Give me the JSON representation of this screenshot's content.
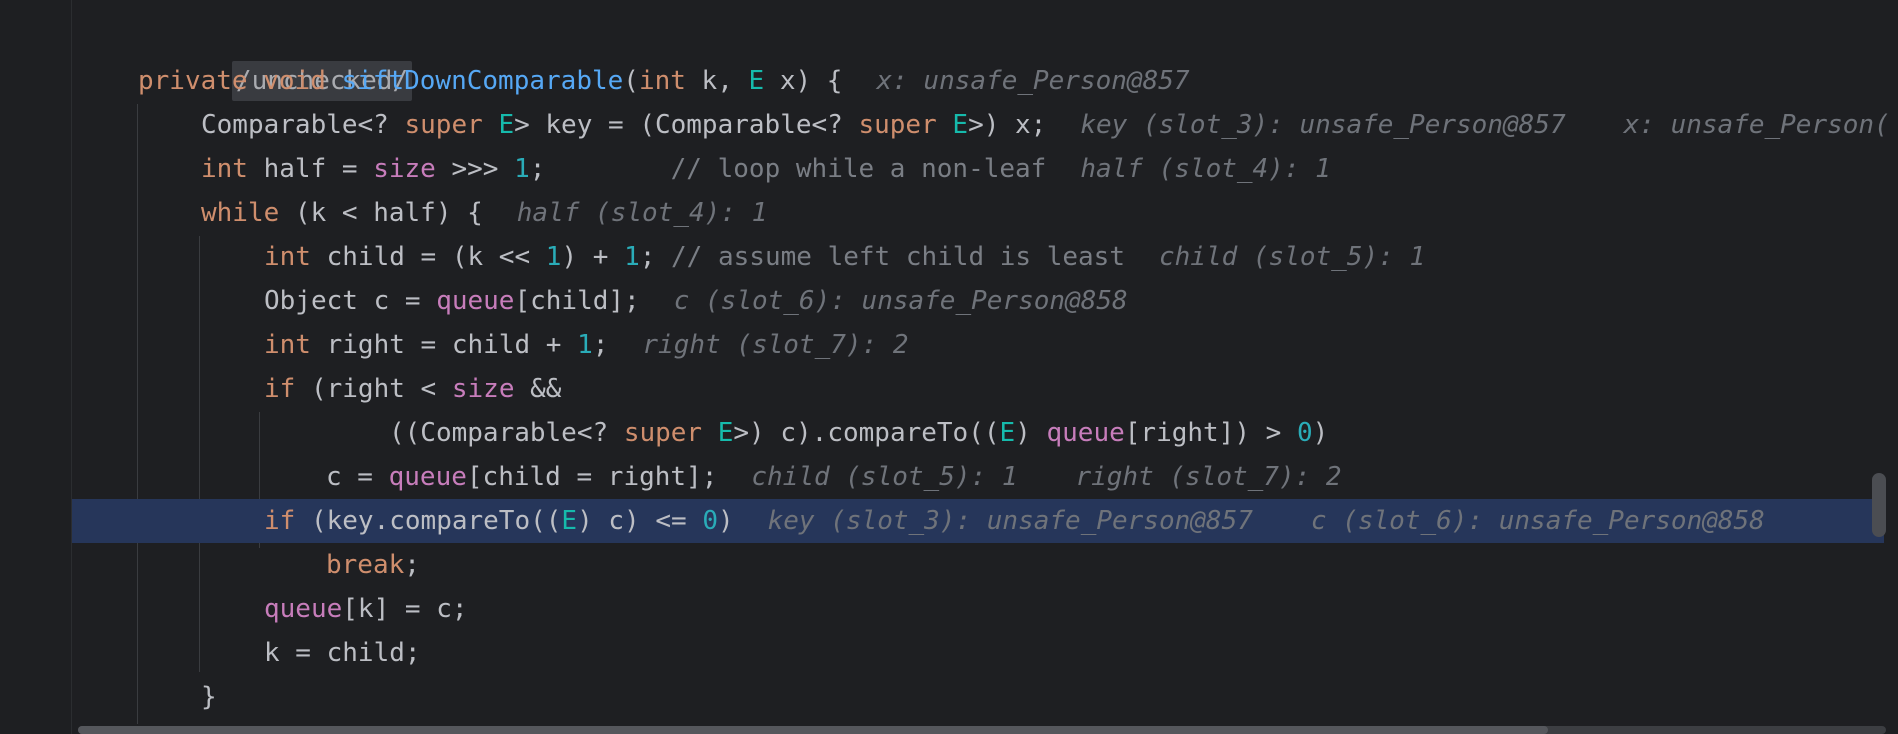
{
  "lines": {
    "l0": {
      "tag": "/unchecked/"
    },
    "l1": {
      "t1": "private",
      "t2": "void",
      "t3": "siftDownComparable",
      "t4": "(",
      "t5": "int",
      "t6": " k, ",
      "t7": "E",
      "t8": " x) {",
      "hint1": "x: unsafe_Person@857"
    },
    "l2": {
      "t1": "Comparable<? ",
      "t2": "super",
      "t3": "E",
      "t4": "> key = (Comparable<? ",
      "t5": "super",
      "t6": "E",
      "t7": ">) x;",
      "hint1": "key (slot_3): unsafe_Person@857",
      "hint2": "x: unsafe_Person("
    },
    "l3": {
      "t1": "int",
      "t2": " half = ",
      "t3": "size",
      "t4": " >>> ",
      "t5": "1",
      "t6": ";",
      "comment": "// loop while a non-leaf",
      "hint1": "half (slot_4): 1"
    },
    "l4": {
      "t1": "while",
      "t2": " (k < half) {",
      "hint1": "half (slot_4): 1"
    },
    "l5": {
      "t1": "int",
      "t2": " child = (k << ",
      "t3": "1",
      "t4": ") + ",
      "t5": "1",
      "t6": ";",
      "comment": "// assume left child is least",
      "hint1": "child (slot_5): 1"
    },
    "l6": {
      "t1": "Object c = ",
      "t2": "queue",
      "t3": "[child];",
      "hint1": "c (slot_6): unsafe_Person@858"
    },
    "l7": {
      "t1": "int",
      "t2": " right = child + ",
      "t3": "1",
      "t4": ";",
      "hint1": "right (slot_7): 2"
    },
    "l8": {
      "t1": "if",
      "t2": " (right < ",
      "t3": "size",
      "t4": " &&"
    },
    "l9": {
      "t1": "((Comparable<? ",
      "t2": "super",
      "t3": "E",
      "t4": ">) c).compareTo((",
      "t5": "E",
      "t6": ") ",
      "t7": "queue",
      "t8": "[right]) > ",
      "t9": "0",
      "t10": ")"
    },
    "l10": {
      "t1": "c = ",
      "t2": "queue",
      "t3": "[child = right];",
      "hint1": "child (slot_5): 1",
      "hint2": "right (slot_7): 2"
    },
    "l11": {
      "t1": "if",
      "t2": " (key.compareTo((",
      "t3": "E",
      "t4": ") c) <= ",
      "t5": "0",
      "t6": ")",
      "hint1": "key (slot_3): unsafe_Person@857",
      "hint2": "c (slot_6): unsafe_Person@858"
    },
    "l12": {
      "t1": "break",
      "t2": ";"
    },
    "l13": {
      "t1": "queue",
      "t2": "[k] = c;"
    },
    "l14": {
      "t1": "k = child;"
    },
    "l15": {
      "t1": "}"
    }
  },
  "colors": {
    "background": "#1e1f22",
    "current_line": "#26365a",
    "keyword": "#cf8e6d",
    "function": "#56a8f5",
    "type_param": "#16baac",
    "field": "#c77dbb",
    "number": "#2aacb8",
    "comment": "#7a7e85",
    "inlay_hint": "#6f737a"
  }
}
